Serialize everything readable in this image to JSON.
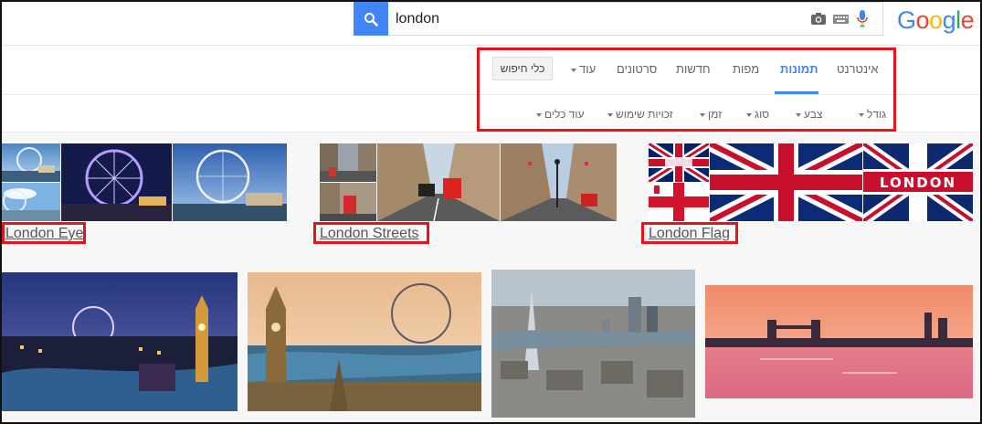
{
  "search": {
    "query": "london"
  },
  "logo": {
    "letters": [
      "G",
      "o",
      "o",
      "g",
      "l",
      "e"
    ],
    "colors": [
      "#4285f4",
      "#ea4335",
      "#fbbc05",
      "#4285f4",
      "#34a853",
      "#ea4335"
    ]
  },
  "tabs": [
    "אינטרנט",
    "תמונות",
    "מפות",
    "חדשות",
    "סרטונים",
    "עוד"
  ],
  "active_tab": "תמונות",
  "tools_button": "כלי חיפוש",
  "tools": [
    "גודל",
    "צבע",
    "סוג",
    "זמן",
    "זכויות שימוש",
    "עוד כלים"
  ],
  "collections": [
    "London Eye",
    "London Streets",
    "London Flag"
  ],
  "flag_text": "LONDON",
  "colors": {
    "accent": "#4285f4",
    "highlight": "#e8121b"
  }
}
